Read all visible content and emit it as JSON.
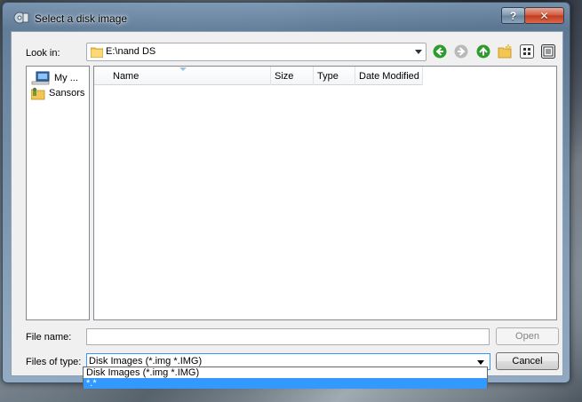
{
  "window": {
    "title": "Select a disk image",
    "help_label": "?",
    "close_label": "✕"
  },
  "lookin": {
    "label": "Look in:",
    "value": "E:\\nand DS"
  },
  "sidebar": {
    "items": [
      {
        "label": "My ...",
        "icon": "computer-icon"
      },
      {
        "label": "Sansors",
        "icon": "user-folder-icon"
      }
    ]
  },
  "filelist": {
    "columns": [
      "Name",
      "Size",
      "Type",
      "Date Modified"
    ]
  },
  "filename": {
    "label": "File name:",
    "value": "",
    "placeholder": ""
  },
  "filetype": {
    "label": "Files of type:",
    "selected": "Disk Images (*.img *.IMG)",
    "options": [
      "Disk Images (*.img *.IMG)",
      "*.*"
    ],
    "highlighted_index": 1
  },
  "buttons": {
    "open": "Open",
    "cancel": "Cancel"
  },
  "colors": {
    "selection": "#3399ff",
    "nav_green": "#2e9b2e"
  }
}
